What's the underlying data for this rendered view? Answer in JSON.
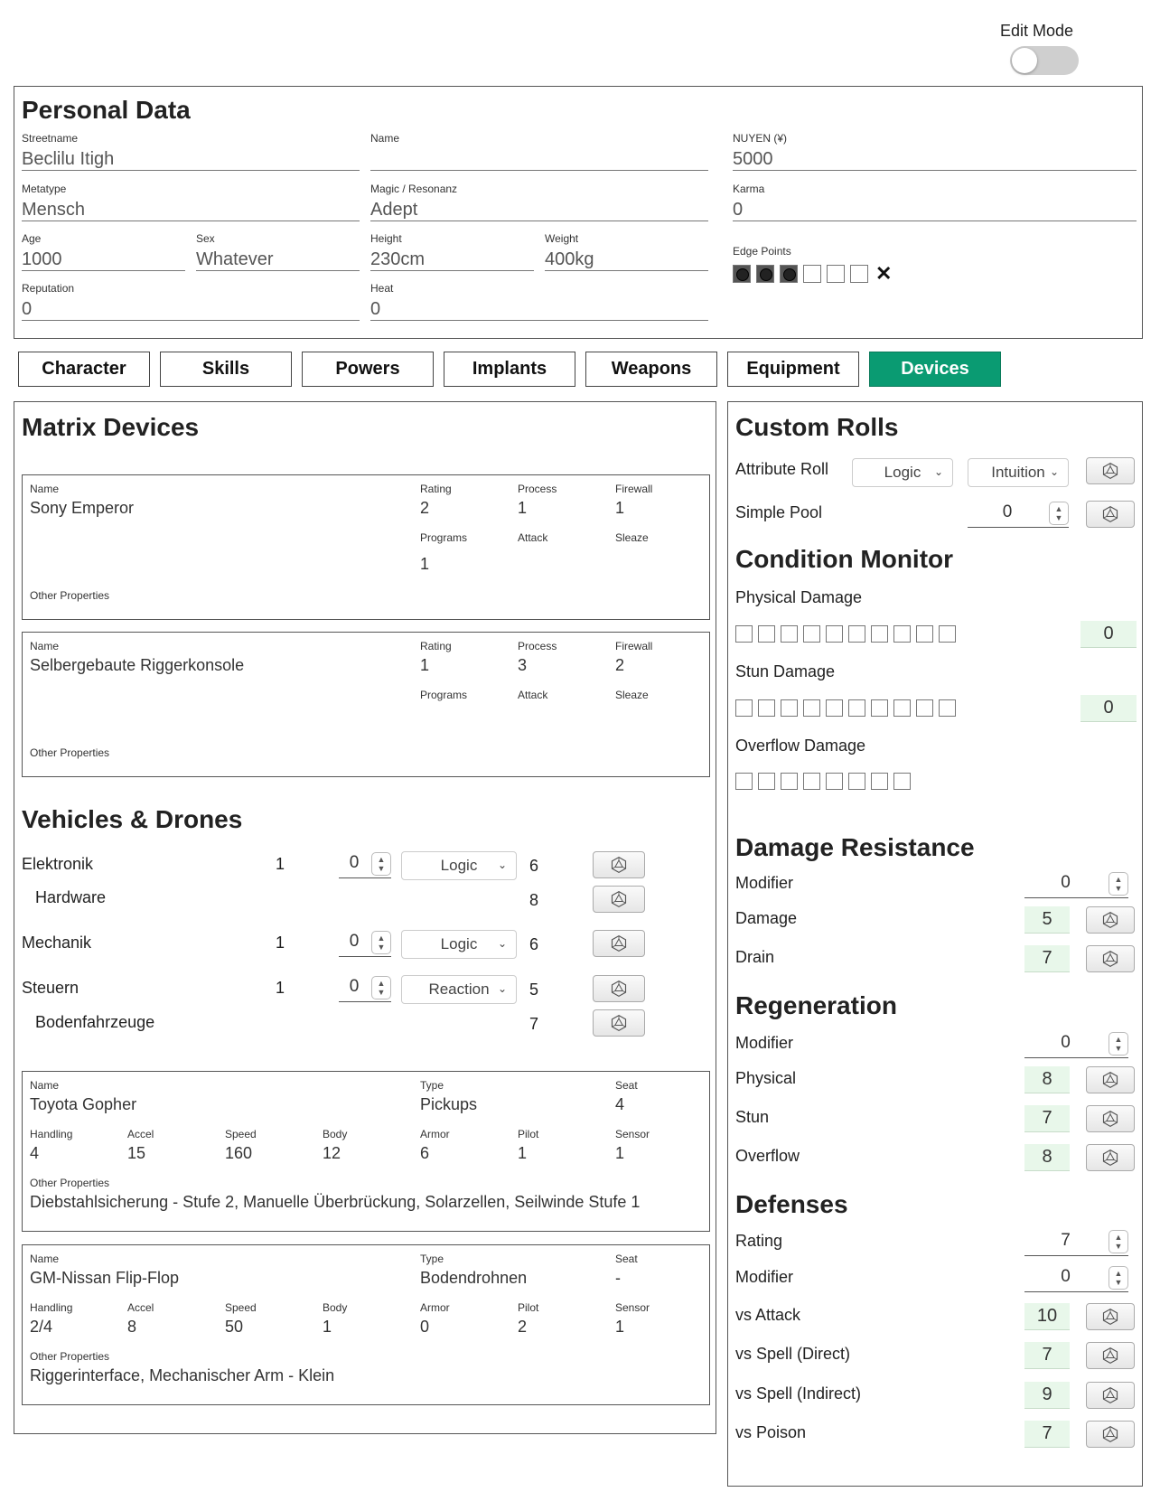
{
  "edit_mode": {
    "label": "Edit Mode",
    "enabled": false
  },
  "personal": {
    "title": "Personal Data",
    "streetname": {
      "label": "Streetname",
      "value": "Beclilu Itigh"
    },
    "name": {
      "label": "Name",
      "value": ""
    },
    "nuyen": {
      "label": "NUYEN (¥)",
      "value": "5000"
    },
    "metatype": {
      "label": "Metatype",
      "value": "Mensch"
    },
    "magic": {
      "label": "Magic / Resonanz",
      "value": "Adept"
    },
    "karma": {
      "label": "Karma",
      "value": "0"
    },
    "age": {
      "label": "Age",
      "value": "1000"
    },
    "sex": {
      "label": "Sex",
      "value": "Whatever"
    },
    "height": {
      "label": "Height",
      "value": "230cm"
    },
    "weight": {
      "label": "Weight",
      "value": "400kg"
    },
    "edge": {
      "label": "Edge Points",
      "filled": 3,
      "total": 6,
      "clear": "✕"
    },
    "reputation": {
      "label": "Reputation",
      "value": "0"
    },
    "heat": {
      "label": "Heat",
      "value": "0"
    }
  },
  "tabs": [
    {
      "label": "Character",
      "active": false
    },
    {
      "label": "Skills",
      "active": false
    },
    {
      "label": "Powers",
      "active": false
    },
    {
      "label": "Implants",
      "active": false
    },
    {
      "label": "Weapons",
      "active": false
    },
    {
      "label": "Equipment",
      "active": false
    },
    {
      "label": "Devices",
      "active": true
    }
  ],
  "colors": {
    "active_tab": "#0a9b72",
    "output_bg": "#e8f7ea"
  },
  "matrix": {
    "title": "Matrix Devices",
    "labels": {
      "name": "Name",
      "rating": "Rating",
      "process": "Process",
      "firewall": "Firewall",
      "programs": "Programs",
      "attack": "Attack",
      "sleaze": "Sleaze",
      "other": "Other Properties"
    },
    "devices": [
      {
        "name": "Sony Emperor",
        "rating": "2",
        "process": "1",
        "firewall": "1",
        "programs": "1",
        "attack": "",
        "sleaze": "",
        "other": ""
      },
      {
        "name": "Selbergebaute Riggerkonsole",
        "rating": "1",
        "process": "3",
        "firewall": "2",
        "programs": "",
        "attack": "",
        "sleaze": "",
        "other": ""
      }
    ]
  },
  "vehicles": {
    "title": "Vehicles & Drones",
    "skills": [
      {
        "name": "Elektronik",
        "rating": "1",
        "mod": "0",
        "attr": "Logic",
        "pool": "6"
      },
      {
        "name": "Hardware",
        "pool": "8",
        "sub": true
      },
      {
        "name": "Mechanik",
        "rating": "1",
        "mod": "0",
        "attr": "Logic",
        "pool": "6"
      },
      {
        "name": "Steuern",
        "rating": "1",
        "mod": "0",
        "attr": "Reaction",
        "pool": "5"
      },
      {
        "name": "Bodenfahrzeuge",
        "pool": "7",
        "sub": true
      }
    ],
    "labels": {
      "name": "Name",
      "type": "Type",
      "seat": "Seat",
      "handling": "Handling",
      "accel": "Accel",
      "speed": "Speed",
      "body": "Body",
      "armor": "Armor",
      "pilot": "Pilot",
      "sensor": "Sensor",
      "other": "Other Properties"
    },
    "items": [
      {
        "name": "Toyota Gopher",
        "type": "Pickups",
        "seat": "4",
        "handling": "4",
        "accel": "15",
        "speed": "160",
        "body": "12",
        "armor": "6",
        "pilot": "1",
        "sensor": "1",
        "other": "Diebstahlsicherung - Stufe 2, Manuelle Überbrückung, Solarzellen, Seilwinde Stufe 1"
      },
      {
        "name": "GM-Nissan Flip-Flop",
        "type": "Bodendrohnen",
        "seat": "-",
        "handling": "2/4",
        "accel": "8",
        "speed": "50",
        "body": "1",
        "armor": "0",
        "pilot": "2",
        "sensor": "1",
        "other": "Riggerinterface, Mechanischer Arm - Klein"
      }
    ]
  },
  "custom_rolls": {
    "title": "Custom Rolls",
    "attribute_roll": {
      "label": "Attribute Roll",
      "attr1": "Logic",
      "attr2": "Intuition"
    },
    "simple_pool": {
      "label": "Simple Pool",
      "value": "0"
    }
  },
  "condition": {
    "title": "Condition Monitor",
    "physical": {
      "label": "Physical Damage",
      "boxes": 10,
      "value": "0"
    },
    "stun": {
      "label": "Stun Damage",
      "boxes": 10,
      "value": "0"
    },
    "overflow": {
      "label": "Overflow Damage",
      "boxes": 8
    }
  },
  "damage_resistance": {
    "title": "Damage Resistance",
    "modifier": {
      "label": "Modifier",
      "value": "0"
    },
    "damage": {
      "label": "Damage",
      "value": "5"
    },
    "drain": {
      "label": "Drain",
      "value": "7"
    }
  },
  "regeneration": {
    "title": "Regeneration",
    "modifier": {
      "label": "Modifier",
      "value": "0"
    },
    "physical": {
      "label": "Physical",
      "value": "8"
    },
    "stun": {
      "label": "Stun",
      "value": "7"
    },
    "overflow": {
      "label": "Overflow",
      "value": "8"
    }
  },
  "defenses": {
    "title": "Defenses",
    "rating": {
      "label": "Rating",
      "value": "7"
    },
    "modifier": {
      "label": "Modifier",
      "value": "0"
    },
    "vs_attack": {
      "label": "vs Attack",
      "value": "10"
    },
    "vs_spell_direct": {
      "label": "vs Spell (Direct)",
      "value": "7"
    },
    "vs_spell_indirect": {
      "label": "vs Spell (Indirect)",
      "value": "9"
    },
    "vs_poison": {
      "label": "vs Poison",
      "value": "7"
    }
  }
}
